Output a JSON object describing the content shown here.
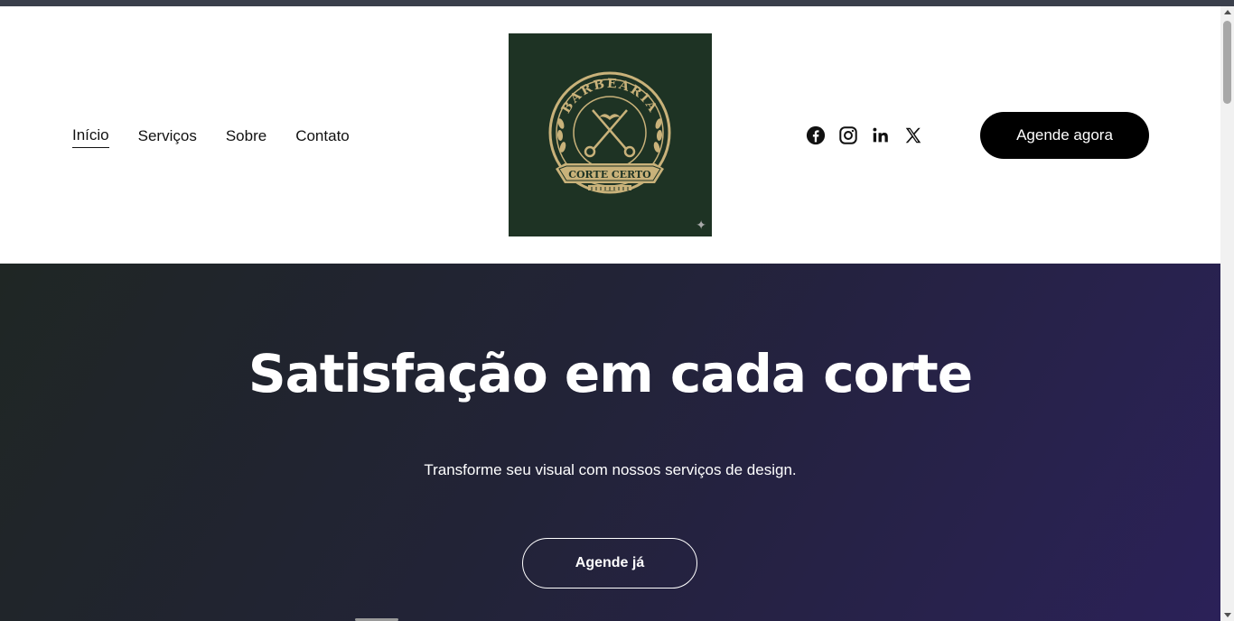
{
  "nav": {
    "items": [
      {
        "label": "Início",
        "active": true
      },
      {
        "label": "Serviços",
        "active": false
      },
      {
        "label": "Sobre",
        "active": false
      },
      {
        "label": "Contato",
        "active": false
      }
    ]
  },
  "logo": {
    "top_text": "BARBEARIA",
    "banner_text": "CORTE CERTO",
    "background": "#1e3324",
    "accent": "#c9b27a"
  },
  "social": [
    "facebook-icon",
    "instagram-icon",
    "linkedin-icon",
    "x-icon"
  ],
  "header_cta": {
    "label": "Agende agora"
  },
  "hero": {
    "title": "Satisfação em cada corte",
    "subtitle": "Transforme seu visual com nossos serviços de design.",
    "cta_label": "Agende já"
  },
  "colors": {
    "hero_start": "#1f2624",
    "hero_end": "#2b2158",
    "cta_bg": "#000000"
  }
}
